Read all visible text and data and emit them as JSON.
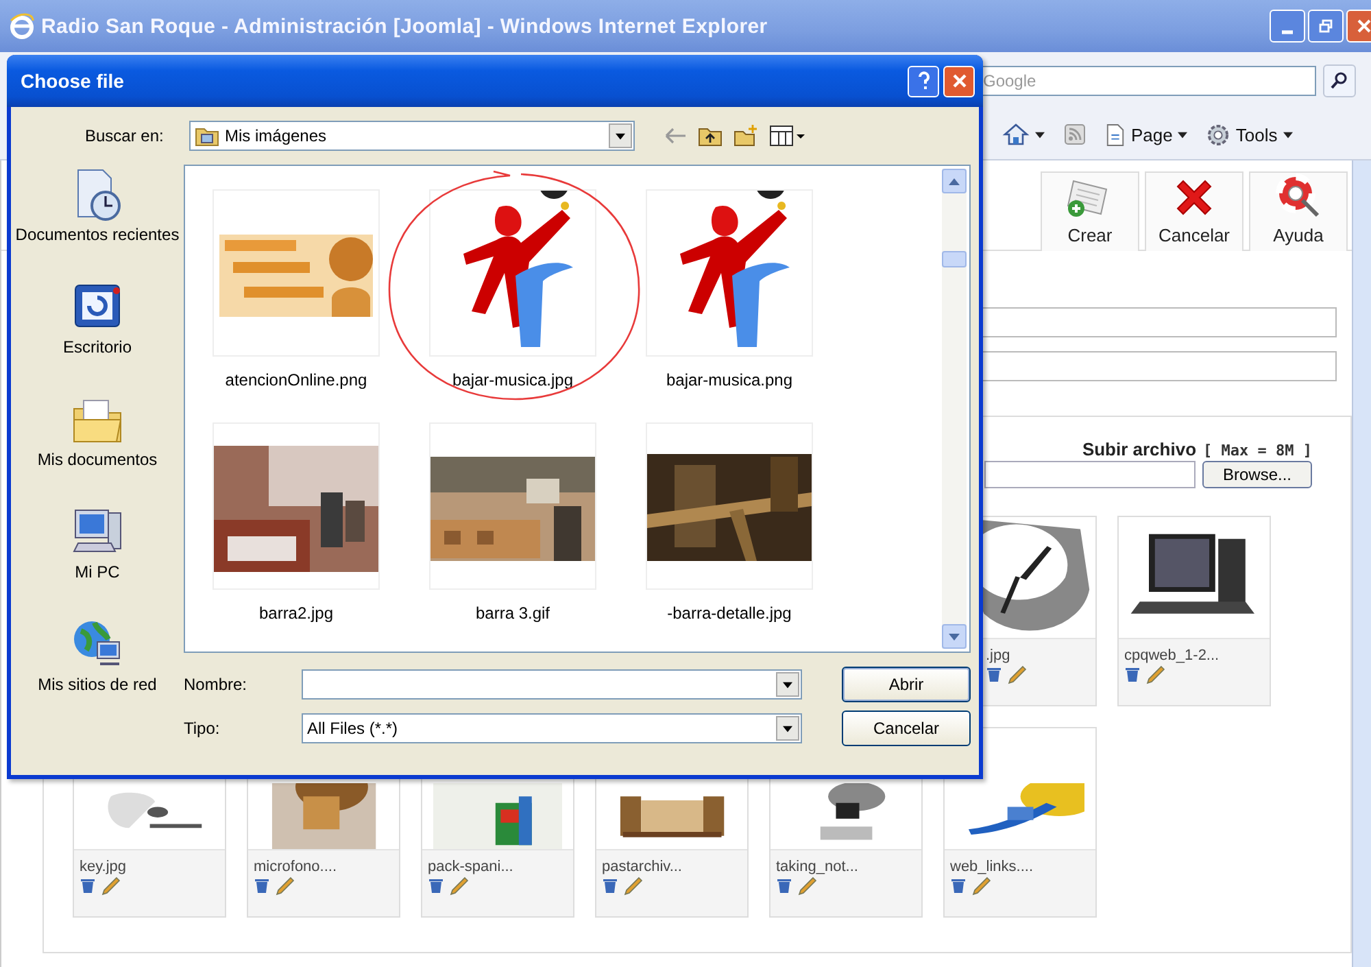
{
  "browser": {
    "title": "Radio San Roque - Administración [Joomla] - Windows Internet Explorer",
    "search_placeholder": "Google",
    "command_bar": [
      {
        "kind": "home"
      },
      {
        "kind": "feeds"
      },
      {
        "kind": "menu",
        "label": "Page"
      },
      {
        "kind": "menu",
        "label": "Tools"
      }
    ]
  },
  "toolbar": [
    {
      "kind": "new",
      "label": "Crear"
    },
    {
      "kind": "cancel",
      "label": "Cancelar"
    },
    {
      "kind": "help",
      "label": "Ayuda"
    }
  ],
  "upload": {
    "label": "Subir archivo",
    "limit": "[ Max = 8M ]",
    "button": "Browse..."
  },
  "media_rows": [
    [
      {
        "label": ".jpg"
      },
      {
        "label": "cpqweb_1-2..."
      }
    ],
    [
      {
        "label": "key.jpg"
      },
      {
        "label": "microfono...."
      },
      {
        "label": "pack-spani..."
      },
      {
        "label": "pastarchiv..."
      },
      {
        "label": "taking_not..."
      },
      {
        "label": "web_links...."
      }
    ]
  ],
  "dialog": {
    "title": "Choose file",
    "look_in_label": "Buscar en:",
    "look_in": "Mis imágenes",
    "places": [
      {
        "kind": "recent",
        "label": "Documentos recientes"
      },
      {
        "kind": "desktop",
        "label": "Escritorio"
      },
      {
        "kind": "documents",
        "label": "Mis documentos"
      },
      {
        "kind": "computer",
        "label": "Mi PC"
      },
      {
        "kind": "network",
        "label": "Mis sitios de red"
      }
    ],
    "files": [
      {
        "label": "atencionOnline.png"
      },
      {
        "label": "bajar-musica.jpg"
      },
      {
        "label": "bajar-musica.png"
      },
      {
        "label": "barra2.jpg"
      },
      {
        "label": "barra 3.gif"
      },
      {
        "label": "-barra-detalle.jpg"
      }
    ],
    "name_label": "Nombre:",
    "type_label": "Tipo:",
    "type_value": "All Files (*.*)",
    "open_button": "Abrir",
    "cancel_button": "Cancelar"
  }
}
